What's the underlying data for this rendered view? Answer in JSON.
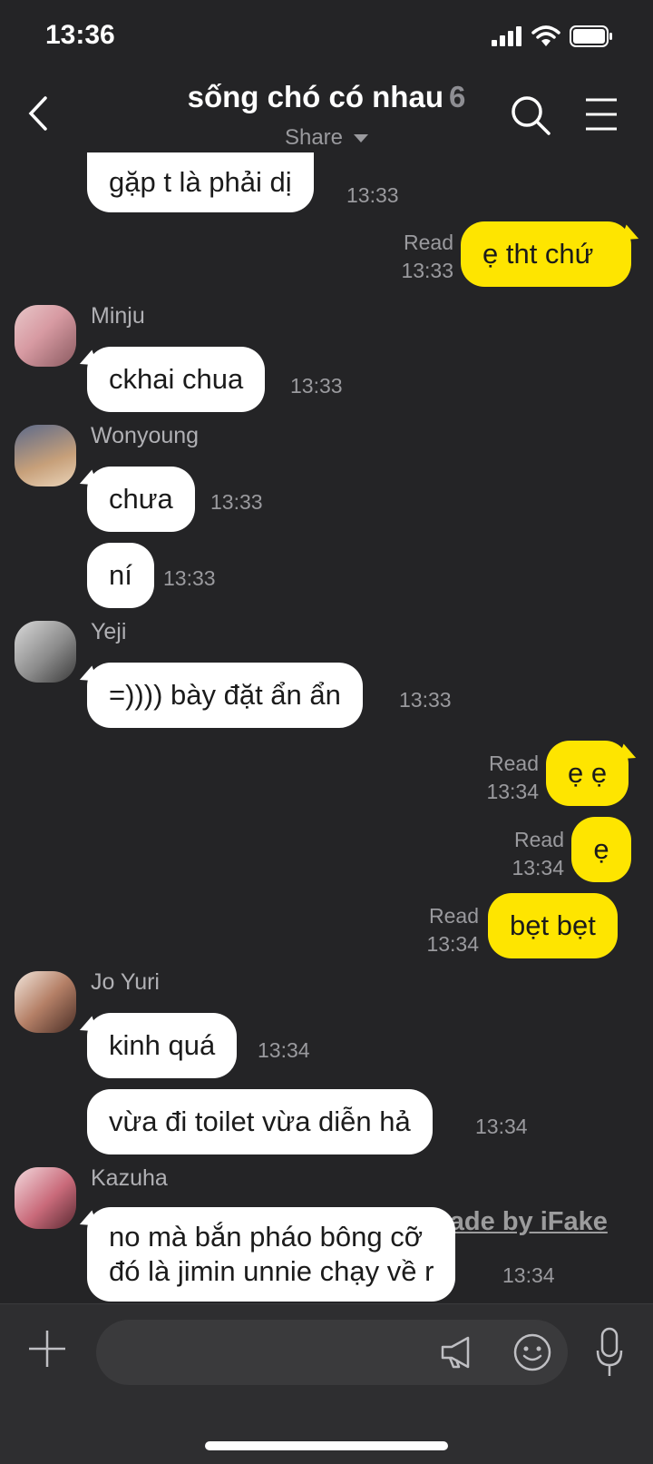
{
  "status_bar": {
    "time": "13:36"
  },
  "header": {
    "title": "sống chó có nhau",
    "member_count": "6",
    "share_label": "Share"
  },
  "messages": [
    {
      "text": "gặp t là phải dị",
      "time": "13:33"
    },
    {
      "text": "ẹ tht chứ",
      "read": "Read",
      "time": "13:33"
    },
    {
      "sender": "Minju",
      "text": "ckhai chua",
      "time": "13:33"
    },
    {
      "sender": "Wonyoung",
      "text": "chưa",
      "time": "13:33"
    },
    {
      "text": "ní",
      "time": "13:33"
    },
    {
      "sender": "Yeji",
      "text": "=)))) bày đặt ẩn ẩn",
      "time": "13:33"
    },
    {
      "text": "ẹ ẹ",
      "read": "Read",
      "time": "13:34"
    },
    {
      "text": "ẹ",
      "read": "Read",
      "time": "13:34"
    },
    {
      "text": "bẹt bẹt",
      "read": "Read",
      "time": "13:34"
    },
    {
      "sender": "Jo Yuri",
      "text": "kinh quá",
      "time": "13:34"
    },
    {
      "text": "vừa đi toilet vừa diễn hả",
      "time": "13:34"
    },
    {
      "sender": "Kazuha",
      "line1": "no mà bắn pháo bông cỡ",
      "line2": "đó là jimin unnie chạy về r",
      "time": "13:34"
    }
  ],
  "watermark": "made by iFake",
  "input": {
    "placeholder": ""
  },
  "colors": {
    "background": "#242426",
    "my_bubble": "#fee500",
    "other_bubble": "#ffffff"
  }
}
